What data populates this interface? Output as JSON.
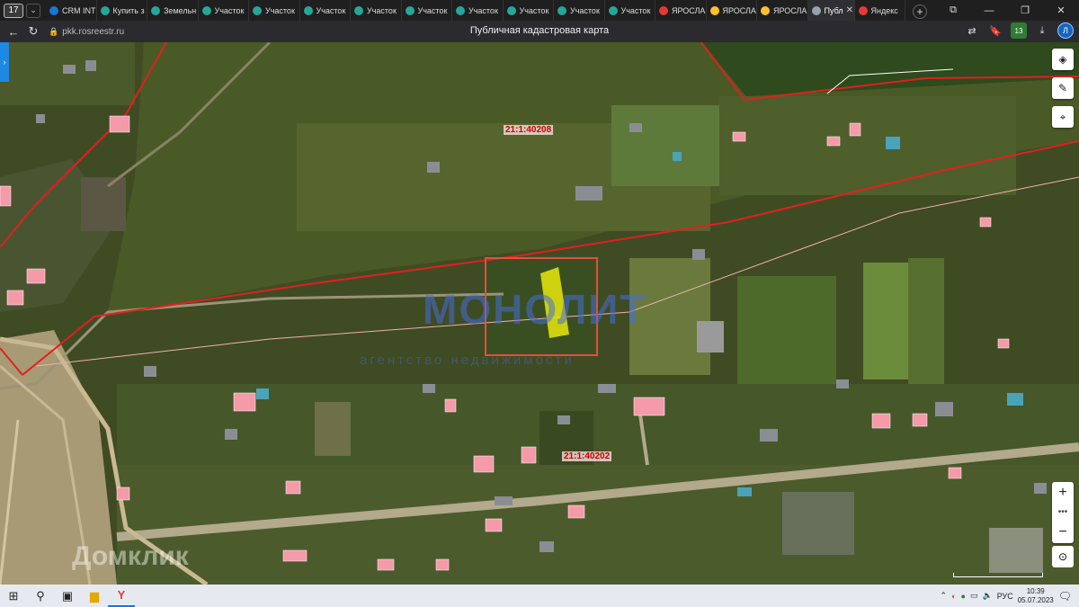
{
  "browser": {
    "tab_count": "17",
    "tabs": [
      {
        "label": "CRM INT",
        "color": "#1976d2"
      },
      {
        "label": "Купить з",
        "color": "#26a69a"
      },
      {
        "label": "Земельн",
        "color": "#26a69a"
      },
      {
        "label": "Участок",
        "color": "#26a69a"
      },
      {
        "label": "Участок",
        "color": "#26a69a"
      },
      {
        "label": "Участок",
        "color": "#26a69a"
      },
      {
        "label": "Участок",
        "color": "#26a69a"
      },
      {
        "label": "Участок",
        "color": "#26a69a"
      },
      {
        "label": "Участок",
        "color": "#26a69a"
      },
      {
        "label": "Участок",
        "color": "#26a69a"
      },
      {
        "label": "Участок",
        "color": "#26a69a"
      },
      {
        "label": "Участок",
        "color": "#26a69a"
      },
      {
        "label": "ЯРОСЛА",
        "color": "#e53935"
      },
      {
        "label": "ЯРОСЛА",
        "color": "#fbc02d"
      },
      {
        "label": "ЯРОСЛА",
        "color": "#fbc02d"
      },
      {
        "label": "Публ",
        "color": "#90a4ae",
        "active": true
      },
      {
        "label": "Яндекс",
        "color": "#e53935"
      }
    ],
    "url": "pkk.rosreestr.ru",
    "page_title": "Публичная кадастровая карта"
  },
  "map": {
    "quarter_labels": [
      "21:1:40208",
      "21:1:40202"
    ],
    "watermark_main": "МОНОЛИТ",
    "watermark_sub": "агентство недвижимости",
    "domclick": "Домклик",
    "accent_red": "#e02020",
    "highlight_yellow": "#e8e80a"
  },
  "taskbar": {
    "lang": "РУС",
    "time": "10:39",
    "date": "05.07.2023"
  }
}
